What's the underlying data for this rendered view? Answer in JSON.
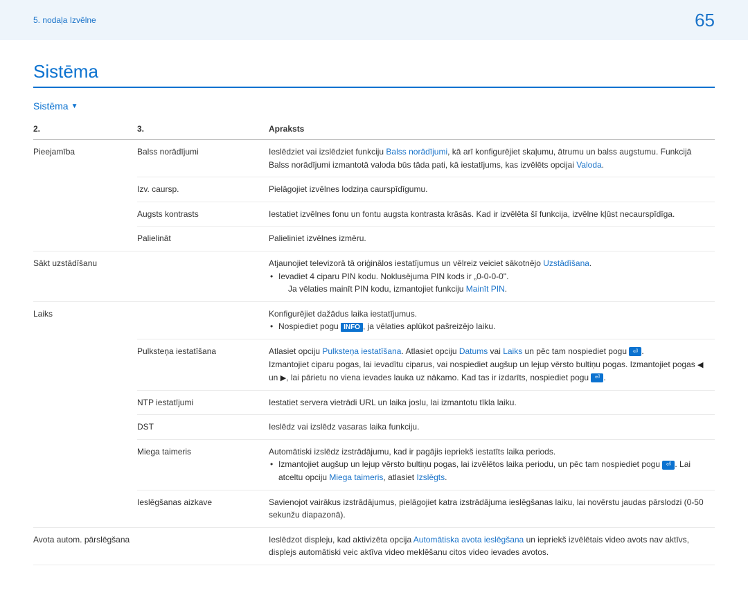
{
  "header": {
    "breadcrumb": "5. nodaļa Izvēlne",
    "pagenum": "65"
  },
  "title": "Sistēma",
  "menupath": "Sistēma",
  "table": {
    "head": {
      "c1": "2.",
      "c2": "3.",
      "c3": "Apraksts"
    }
  },
  "rows": {
    "r1": {
      "lvl2": "Pieejamība",
      "lvl3": "Balss norādījumi",
      "desc_a": "Ieslēdziet vai izslēdziet funkciju ",
      "desc_link1": "Balss norādījumi",
      "desc_b": ", kā arī konfigurējiet skaļumu, ātrumu un balss augstumu. Funkcijā Balss norādījumi izmantotā valoda būs tāda pati, kā iestatījums, kas izvēlēts opcijai ",
      "desc_link2": "Valoda",
      "desc_c": "."
    },
    "r2": {
      "lvl3": "Izv. caursp.",
      "desc": "Pielāgojiet izvēlnes lodziņa caurspīdīgumu."
    },
    "r3": {
      "lvl3": "Augsts kontrasts",
      "desc": "Iestatiet izvēlnes fonu un fontu augsta kontrasta krāsās. Kad ir izvēlēta šī funkcija, izvēlne kļūst necaurspīdīga."
    },
    "r4": {
      "lvl3": "Palielināt",
      "desc": "Palieliniet izvēlnes izmēru."
    },
    "r5": {
      "lvl2": "Sākt uzstādīšanu",
      "desc_a": "Atjaunojiet televizorā tā oriģinālos iestatījumus un vēlreiz veiciet sākotnējo ",
      "link1": "Uzstādīšana",
      "desc_b": ".",
      "bullet_a": "Ievadiet 4 ciparu PIN kodu. Noklusējuma PIN kods ir „0-0-0-0\".",
      "bullet_b1": "Ja vēlaties mainīt PIN kodu, izmantojiet funkciju ",
      "bullet_link": "Mainīt PIN",
      "bullet_b2": "."
    },
    "r6": {
      "lvl2": "Laiks",
      "desc": "Konfigurējiet dažādus laika iestatījumus.",
      "bullet_a": "Nospiediet pogu ",
      "badge": "INFO",
      "bullet_b": ", ja vēlaties aplūkot pašreizējo laiku."
    },
    "r7": {
      "lvl3": "Pulksteņa iestatīšana",
      "a": "Atlasiet opciju ",
      "link1": "Pulksteņa iestatīšana",
      "b": ". Atlasiet opciju ",
      "link2": "Datums",
      "c": " vai ",
      "link3": "Laiks",
      "d": " un pēc tam nospiediet pogu ",
      "e": ".",
      "line2a": "Izmantojiet ciparu pogas, lai ievadītu ciparus, vai nospiediet augšup un lejup vērsto bultiņu pogas. Izmantojiet pogas ",
      "line2b": " un ",
      "line2c": ", lai pārietu no viena ievades lauka uz nākamo. Kad tas ir izdarīts, nospiediet pogu ",
      "line2d": "."
    },
    "r8": {
      "lvl3": "NTP iestatījumi",
      "desc": "Iestatiet servera vietrādi URL un laika joslu, lai izmantotu tīkla laiku."
    },
    "r9": {
      "lvl3": "DST",
      "desc": "Ieslēdz vai izslēdz vasaras laika funkciju."
    },
    "r10": {
      "lvl3": "Miega taimeris",
      "desc": "Automātiski izslēdz izstrādājumu, kad ir pagājis iepriekš iestatīts laika periods.",
      "bullet_a": "Izmantojiet augšup un lejup vērsto bultiņu pogas, lai izvēlētos laika periodu, un pēc tam nospiediet pogu ",
      "bullet_b": ". Lai atceltu opciju ",
      "link1": "Miega taimeris",
      "bullet_c": ", atlasiet ",
      "link2": "Izslēgts",
      "bullet_d": "."
    },
    "r11": {
      "lvl3": "Ieslēgšanas aizkave",
      "desc": "Savienojot vairākus izstrādājumus, pielāgojiet katra izstrādājuma ieslēgšanas laiku, lai novērstu jaudas pārslodzi (0-50 sekunžu diapazonā)."
    },
    "r12": {
      "lvl2": "Avota autom. pārslēgšana",
      "a": "Ieslēdzot displeju, kad aktivizēta opcija ",
      "link1": "Automātiska avota ieslēgšana",
      "b": " un iepriekš izvēlētais video avots nav aktīvs, displejs automātiski veic aktīva video meklēšanu citos video ievades avotos."
    }
  }
}
